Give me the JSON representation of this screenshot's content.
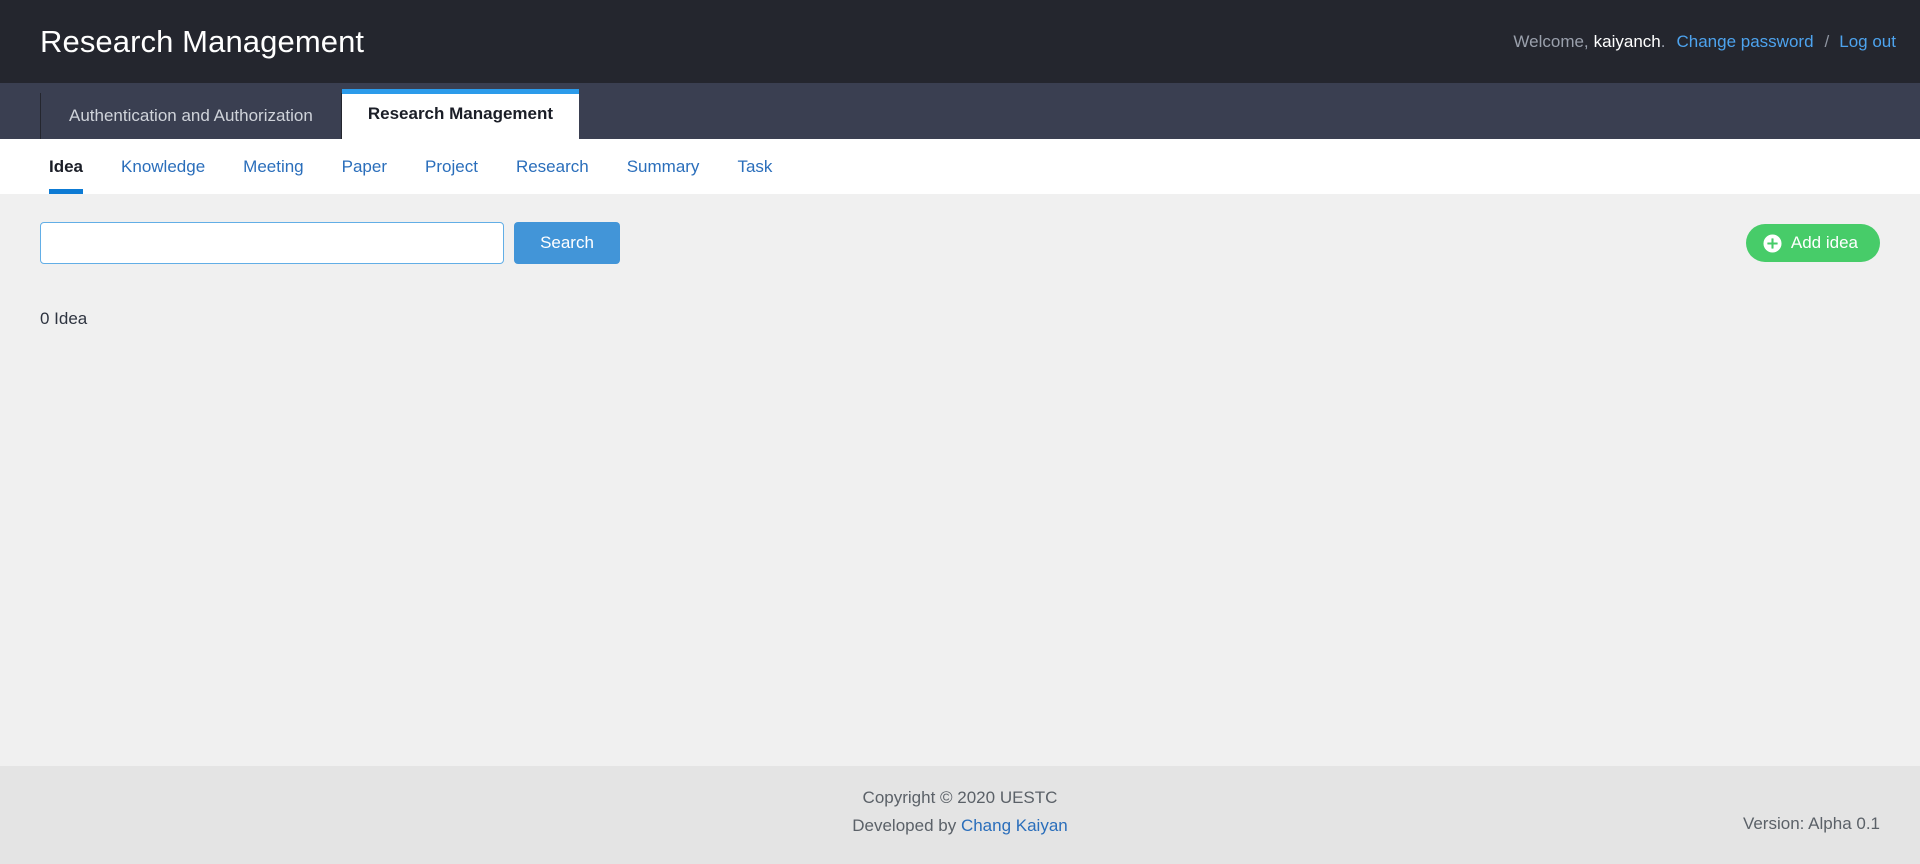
{
  "header": {
    "brand_title": "Research Management",
    "welcome_label": "Welcome,",
    "welcome_user": "kaiyanch",
    "welcome_dot": ".",
    "change_password_label": "Change password",
    "separator": "/",
    "logout_label": "Log out"
  },
  "app_tabs": [
    {
      "label": "Authentication and Authorization",
      "active": false
    },
    {
      "label": "Research Management",
      "active": true
    }
  ],
  "section_nav": [
    {
      "label": "Idea",
      "active": true
    },
    {
      "label": "Knowledge",
      "active": false
    },
    {
      "label": "Meeting",
      "active": false
    },
    {
      "label": "Paper",
      "active": false
    },
    {
      "label": "Project",
      "active": false
    },
    {
      "label": "Research",
      "active": false
    },
    {
      "label": "Summary",
      "active": false
    },
    {
      "label": "Task",
      "active": false
    }
  ],
  "main": {
    "search_value": "",
    "search_placeholder": "",
    "search_button_label": "Search",
    "add_button_label": "Add idea",
    "add_button_icon": "plus-circle-icon",
    "result_count_text": "0 Idea"
  },
  "footer": {
    "copyright": "Copyright © 2020 UESTC",
    "developed_by_prefix": "Developed by ",
    "developer_name": "Chang Kaiyan",
    "version": "Version: Alpha 0.1"
  },
  "colors": {
    "topbar_bg": "#24262e",
    "tabstrip_bg": "#3a3f51",
    "accent_blue": "#2b9bea",
    "link_blue": "#2a6ebb",
    "nav_active_underline": "#0d7bd4",
    "search_button": "#4295d8",
    "add_button_green": "#47cc69",
    "page_bg": "#f0f0f0",
    "footer_bg": "#e4e4e4"
  }
}
